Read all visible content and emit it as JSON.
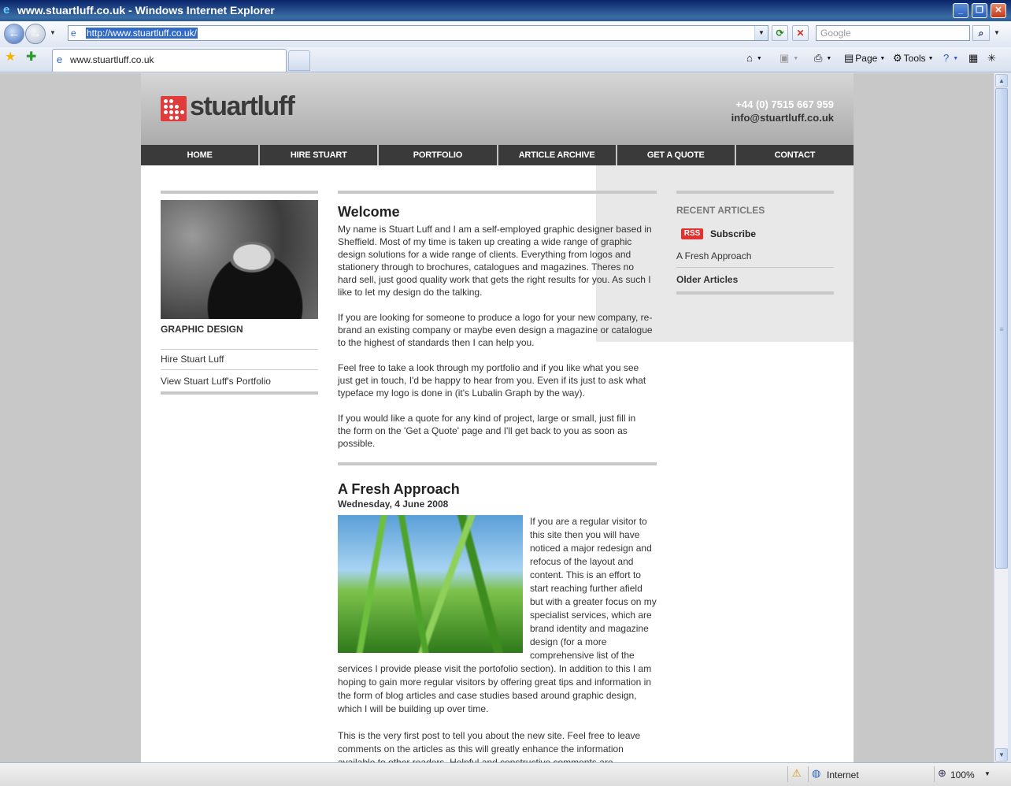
{
  "browser": {
    "window_title": "www.stuartluff.co.uk - Windows Internet Explorer",
    "address": "http://www.stuartluff.co.uk/",
    "search_placeholder": "Google",
    "tab_title": "www.stuartluff.co.uk",
    "commands": {
      "page": "Page",
      "tools": "Tools"
    },
    "status": {
      "zone": "Internet",
      "zoom": "100%"
    }
  },
  "site": {
    "logo_text": "stuartluff",
    "phone": "+44 (0) 7515 667 959",
    "email": "info@stuartluff.co.uk",
    "nav": [
      "HOME",
      "HIRE STUART",
      "PORTFOLIO",
      "ARTICLE ARCHIVE",
      "GET A QUOTE",
      "CONTACT"
    ],
    "sidebar": {
      "heading": "GRAPHIC DESIGN",
      "links": [
        "Hire Stuart Luff",
        "View Stuart Luff's Portfolio"
      ]
    },
    "welcome": {
      "title": "Welcome",
      "p1": "My name is Stuart Luff and I am a self-employed graphic designer based in Sheffield. Most of my time is taken up creating a wide range of graphic design solutions for a wide range of clients. Everything from logos and stationery through to brochures, catalogues and magazines. Theres no hard sell, just good quality work that gets the right results for you. As such I like to let my design do the talking.",
      "p2": "If you are looking for someone to produce a logo for your new company, re-brand an existing company or maybe even design a magazine or catalogue to the highest of standards then I can help you.",
      "p3": "Feel free to take a look through my portfolio and if you like what you see just get in touch, I'd be happy to hear from you. Even if its just to ask what typeface my logo is done in (it's Lubalin Graph by the way).",
      "p4": "If you would like a quote for any kind of project, large or small, just fill in the form on the 'Get a Quote' page and I'll get back to you as soon as possible."
    },
    "article": {
      "title": "A Fresh Approach",
      "date": "Wednesday, 4 June 2008",
      "p1": "If you are a regular visitor to this site then you will have noticed a major redesign and refocus of the layout and content. This is an effort to start reaching further afield but with a greater focus on my specialist services, which are brand identity and magazine design (for a more comprehensive list of the services I provide please visit the portofolio section). In addition to this I am hoping to gain more regular visitors by offering great tips and information in the form of blog articles and case studies based around graphic design, which I will be building up over time.",
      "p2": "This is the very first post to tell you about the new site. Feel free to leave comments on the articles as this will greatly enhance the information available to other readers. Helpful and constructive comments are"
    },
    "recent": {
      "heading": "RECENT ARTICLES",
      "rss_badge": "RSS",
      "subscribe": "Subscribe",
      "items": [
        "A Fresh Approach"
      ],
      "older": "Older Articles"
    }
  }
}
